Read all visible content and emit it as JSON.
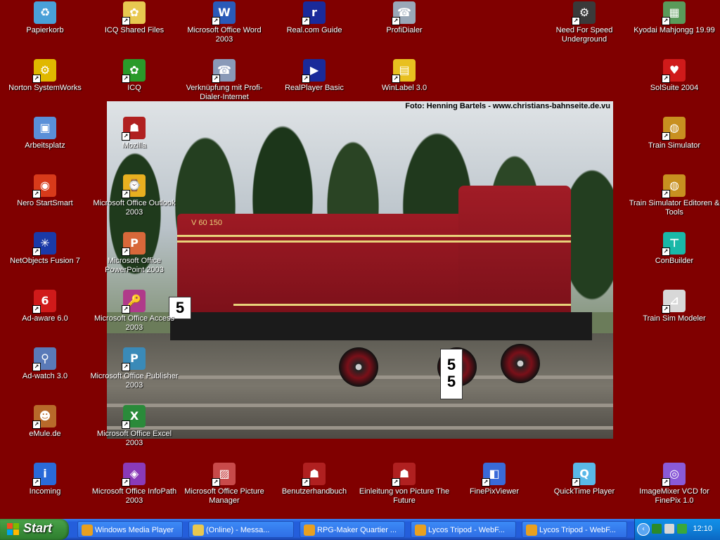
{
  "wallpaper": {
    "caption": "Foto: Henning Bartels - www.christians-bahnseite.de.vu",
    "loco_number": "V 60 150",
    "plate_left": "5",
    "plate_post": "5\n5"
  },
  "icons": [
    {
      "label": "Papierkorb",
      "name": "recycle-bin-icon",
      "color": "#4aa0d8",
      "sym": "♻"
    },
    {
      "label": "Norton SystemWorks",
      "name": "norton-icon",
      "color": "#e0b800",
      "sym": "⚙"
    },
    {
      "label": "Arbeitsplatz",
      "name": "my-computer-icon",
      "color": "#5a8fd8",
      "sym": "▣"
    },
    {
      "label": "Nero StartSmart",
      "name": "nero-icon",
      "color": "#d83a1a",
      "sym": "◉"
    },
    {
      "label": "NetObjects Fusion 7",
      "name": "netobjects-icon",
      "color": "#1a3aa8",
      "sym": "✳"
    },
    {
      "label": "Ad-aware 6.0",
      "name": "adaware-icon",
      "color": "#d01a1a",
      "sym": "6"
    },
    {
      "label": "Ad-watch 3.0",
      "name": "adwatch-icon",
      "color": "#5a7ab8",
      "sym": "⚲"
    },
    {
      "label": "eMule.de",
      "name": "emule-icon",
      "color": "#b86a2a",
      "sym": "☻"
    },
    {
      "label": "Incoming",
      "name": "info-icon",
      "color": "#2a6ad8",
      "sym": "i"
    },
    {
      "label": "ICQ Shared Files",
      "name": "icq-shared-files-icon",
      "color": "#e8c850",
      "sym": "✿"
    },
    {
      "label": "ICQ",
      "name": "icq-icon",
      "color": "#2a9a2a",
      "sym": "✿"
    },
    {
      "label": "Mozilla",
      "name": "mozilla-icon",
      "color": "#b02020",
      "sym": "☗"
    },
    {
      "label": "Microsoft Office Outlook 2003",
      "name": "outlook-icon",
      "color": "#e8b020",
      "sym": "⌚"
    },
    {
      "label": "Microsoft Office PowerPoint 2003",
      "name": "powerpoint-icon",
      "color": "#d8683a",
      "sym": "P"
    },
    {
      "label": "Microsoft Office Access 2003",
      "name": "access-icon",
      "color": "#b03a8a",
      "sym": "🔑"
    },
    {
      "label": "Microsoft Office Publisher 2003",
      "name": "publisher-icon",
      "color": "#3a8ab8",
      "sym": "P"
    },
    {
      "label": "Microsoft Office Excel 2003",
      "name": "excel-icon",
      "color": "#2a8a3a",
      "sym": "X"
    },
    {
      "label": "Microsoft Office InfoPath 2003",
      "name": "infopath-icon",
      "color": "#8a3ab8",
      "sym": "◈"
    },
    {
      "label": "Microsoft Office Word 2003",
      "name": "word-icon",
      "color": "#2a5ab8",
      "sym": "W"
    },
    {
      "label": "Verknüpfung mit Profi-Dialer-Internet",
      "name": "profi-dialer-internet-icon",
      "color": "#8a9ab8",
      "sym": "☎"
    },
    {
      "label": "Microsoft Office Picture Manager",
      "name": "picture-manager-icon",
      "color": "#c84a4a",
      "sym": "▨"
    },
    {
      "label": "Real.com Guide",
      "name": "real-guide-icon",
      "color": "#1a2a9a",
      "sym": "r"
    },
    {
      "label": "RealPlayer Basic",
      "name": "realplayer-icon",
      "color": "#1a2a9a",
      "sym": "▶"
    },
    {
      "label": "Benutzerhandbuch",
      "name": "user-manual-icon",
      "color": "#b02020",
      "sym": "☗"
    },
    {
      "label": "ProfiDialer",
      "name": "profidialer-icon",
      "color": "#9aa8b8",
      "sym": "☎"
    },
    {
      "label": "WinLabel 3.0",
      "name": "winlabel-icon",
      "color": "#e8c020",
      "sym": "▤"
    },
    {
      "label": "Einleitung von Picture The Future",
      "name": "picture-the-future-icon",
      "color": "#b02020",
      "sym": "☗"
    },
    {
      "label": "FinePixViewer",
      "name": "finepix-viewer-icon",
      "color": "#3a6ad8",
      "sym": "◧"
    },
    {
      "label": "QuickTime Player",
      "name": "quicktime-icon",
      "color": "#5ab8e8",
      "sym": "Q"
    },
    {
      "label": "Need For Speed Underground",
      "name": "nfs-underground-icon",
      "color": "#3a3a3a",
      "sym": "⚙"
    },
    {
      "label": "Kyodai Mahjongg 19.99",
      "name": "mahjongg-icon",
      "color": "#5a9a5a",
      "sym": "▦"
    },
    {
      "label": "SolSuite 2004",
      "name": "solsuite-icon",
      "color": "#d01a1a",
      "sym": "♥"
    },
    {
      "label": "Train Simulator",
      "name": "train-simulator-icon",
      "color": "#c89020",
      "sym": "◍"
    },
    {
      "label": "Train Simulator Editoren & Tools",
      "name": "train-simulator-tools-icon",
      "color": "#c89020",
      "sym": "◍"
    },
    {
      "label": "ConBuilder",
      "name": "conbuilder-icon",
      "color": "#1ab8a8",
      "sym": "⊤"
    },
    {
      "label": "Train Sim Modeler",
      "name": "train-sim-modeler-icon",
      "color": "#d8d8d8",
      "sym": "⊿"
    },
    {
      "label": "ImageMixer VCD for FinePix 1.0",
      "name": "imagemixer-icon",
      "color": "#8a5ad8",
      "sym": "◎"
    }
  ],
  "taskbar": {
    "start_label": "Start",
    "tasks": [
      {
        "label": "Windows Media Player",
        "name": "task-windows-media-player",
        "color": "#e8a020"
      },
      {
        "label": "(Online) - Messa...",
        "name": "task-messenger",
        "color": "#e8c850"
      },
      {
        "label": "RPG-Maker Quartier ...",
        "name": "task-rpg-maker",
        "color": "#e8a020"
      },
      {
        "label": "Lycos Tripod - WebF...",
        "name": "task-lycos-tripod-1",
        "color": "#e8a020"
      },
      {
        "label": "Lycos Tripod - WebF...",
        "name": "task-lycos-tripod-2",
        "color": "#e8a020"
      }
    ],
    "clock": "12:10",
    "chevron": "‹"
  }
}
